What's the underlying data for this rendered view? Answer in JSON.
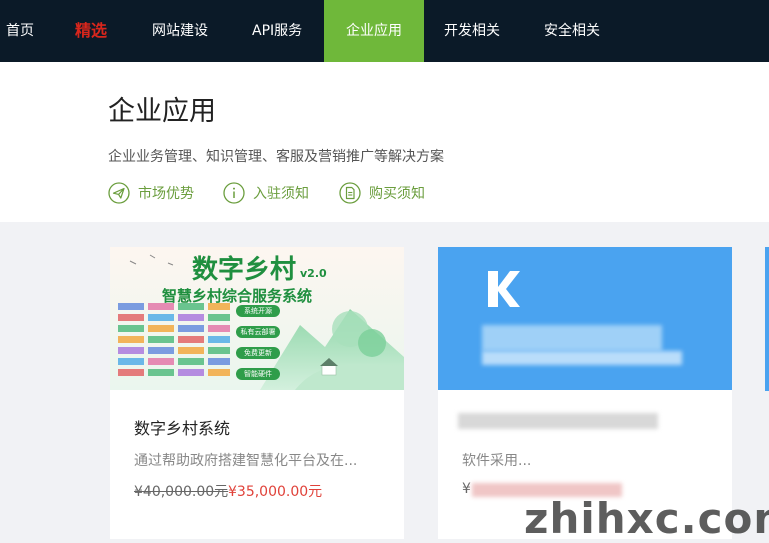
{
  "nav": {
    "items": [
      {
        "label": "首页"
      },
      {
        "label": "精选"
      },
      {
        "label": "网站建设"
      },
      {
        "label": "API服务"
      },
      {
        "label": "企业应用"
      },
      {
        "label": "开发相关"
      },
      {
        "label": "安全相关"
      }
    ],
    "active_index": 4,
    "active_color": "#6fb83a",
    "featured_color": "#d9261c",
    "background": "#0b1a28"
  },
  "hero": {
    "title": "企业应用",
    "subtitle": "企业业务管理、知识管理、客服及营销推广等解决方案",
    "links": [
      {
        "label": "市场优势",
        "icon": "paper-plane-icon"
      },
      {
        "label": "入驻须知",
        "icon": "info-icon"
      },
      {
        "label": "购买须知",
        "icon": "document-icon"
      }
    ],
    "link_color": "#6b9e3e"
  },
  "cards": [
    {
      "image_title": "数字乡村",
      "image_version": "v2.0",
      "image_subtitle": "智慧乡村综合服务系统",
      "image_tags": [
        "系统开源",
        "私有云部署",
        "免费更新",
        "智能硬件"
      ],
      "title": "数字乡村系统",
      "description": "通过帮助政府搭建智慧化平台及在...",
      "original_price": "¥40,000.00元",
      "price": "¥35,000.00元"
    },
    {
      "description": "软件采用...",
      "price_prefix": "¥",
      "banner_color": "#4aa3f0"
    }
  ],
  "watermark": "zhihxc.com"
}
